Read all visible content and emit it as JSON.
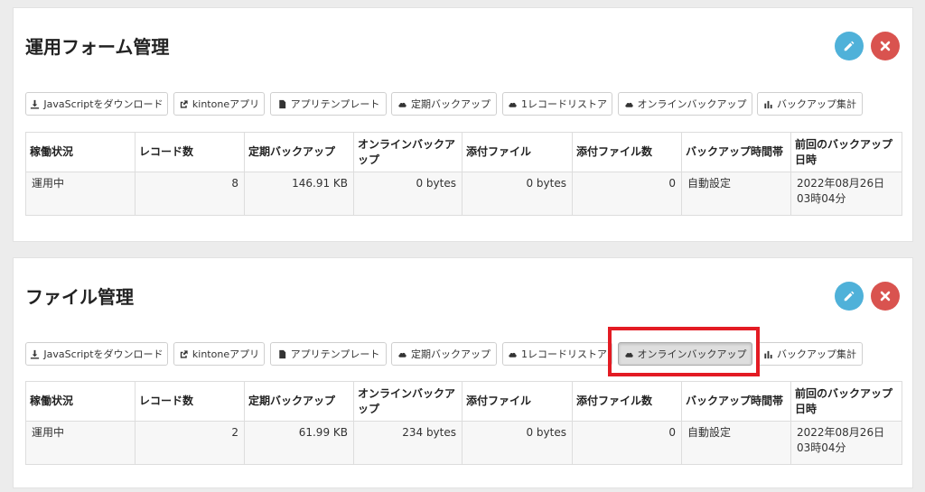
{
  "toolbar_labels": {
    "download_js": "JavaScriptをダウンロード",
    "kintone_app": "kintoneアプリ",
    "app_template": "アプリテンプレート",
    "scheduled_backup": "定期バックアップ",
    "one_record_restore": "1レコードリストア",
    "online_backup": "オンラインバックアップ",
    "backup_stats": "バックアップ集計"
  },
  "table_headers": {
    "status": "稼働状況",
    "record_count": "レコード数",
    "scheduled_backup": "定期バックアップ",
    "online_backup": "オンラインバックアップ",
    "attachments": "添付ファイル",
    "attachment_count": "添付ファイル数",
    "backup_time": "バックアップ時間帯",
    "last_backup": "前回のバックアップ日時"
  },
  "cards": [
    {
      "title": "運用フォーム管理",
      "row": {
        "status": "運用中",
        "record_count": "8",
        "scheduled_backup": "146.91 KB",
        "online_backup": "0 bytes",
        "attachments": "0 bytes",
        "attachment_count": "0",
        "backup_time": "自動設定",
        "last_backup": "2022年08月26日03時04分"
      }
    },
    {
      "title": "ファイル管理",
      "active_button": "online_backup",
      "row": {
        "status": "運用中",
        "record_count": "2",
        "scheduled_backup": "61.99 KB",
        "online_backup": "234 bytes",
        "attachments": "0 bytes",
        "attachment_count": "0",
        "backup_time": "自動設定",
        "last_backup": "2022年08月26日03時04分"
      }
    }
  ],
  "icons": {
    "edit": "pencil-icon",
    "delete": "close-icon",
    "download": "download-icon",
    "external": "external-link-icon",
    "file": "file-icon",
    "cloud": "cloud-icon",
    "chart": "bar-chart-icon"
  },
  "colors": {
    "edit_button": "#4fb1d9",
    "delete_button": "#d9534f",
    "highlight": "#e31b23"
  }
}
